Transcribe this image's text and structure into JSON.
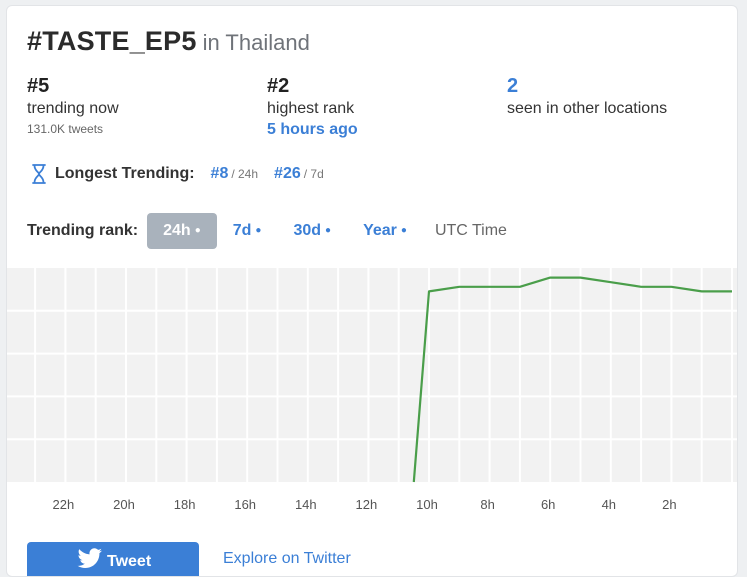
{
  "header": {
    "hashtag": "#TASTE_EP5",
    "location": "in Thailand"
  },
  "stats": {
    "current": {
      "rank": "#5",
      "label": "trending now",
      "tweets": "131.0K tweets"
    },
    "highest": {
      "rank": "#2",
      "label": "highest rank",
      "when": "5 hours ago"
    },
    "other": {
      "count": "2",
      "label": "seen in other locations"
    }
  },
  "longest": {
    "label": "Longest Trending:",
    "r24": "#8",
    "p24": "/ 24h",
    "r7": "#26",
    "p7": "/ 7d"
  },
  "ranks": {
    "label": "Trending rank:",
    "tabs": [
      {
        "label": "24h",
        "active": true
      },
      {
        "label": "7d",
        "active": false
      },
      {
        "label": "30d",
        "active": false
      },
      {
        "label": "Year",
        "active": false
      }
    ],
    "timezone": "UTC Time"
  },
  "footer": {
    "tweet_label": "Tweet",
    "explore_label": "Explore on Twitter"
  },
  "colors": {
    "accent": "#3b7fd6",
    "line": "#4a9e4a",
    "grid_bg": "#f2f2f2"
  },
  "chart_data": {
    "type": "line",
    "x_ticks": [
      "22h",
      "20h",
      "18h",
      "16h",
      "14h",
      "12h",
      "10h",
      "8h",
      "6h",
      "4h",
      "2h"
    ],
    "x_hours_ago": [
      23,
      22,
      21,
      20,
      19,
      18,
      17,
      16,
      15,
      14,
      13,
      12,
      11,
      10.5,
      10,
      9,
      8,
      7,
      6,
      5,
      4,
      3,
      2,
      1,
      0
    ],
    "rank": [
      null,
      null,
      null,
      null,
      null,
      null,
      null,
      null,
      null,
      null,
      null,
      null,
      null,
      50,
      5,
      4,
      4,
      4,
      2,
      2,
      3,
      4,
      4,
      5,
      5
    ],
    "y_inverted": true
  }
}
